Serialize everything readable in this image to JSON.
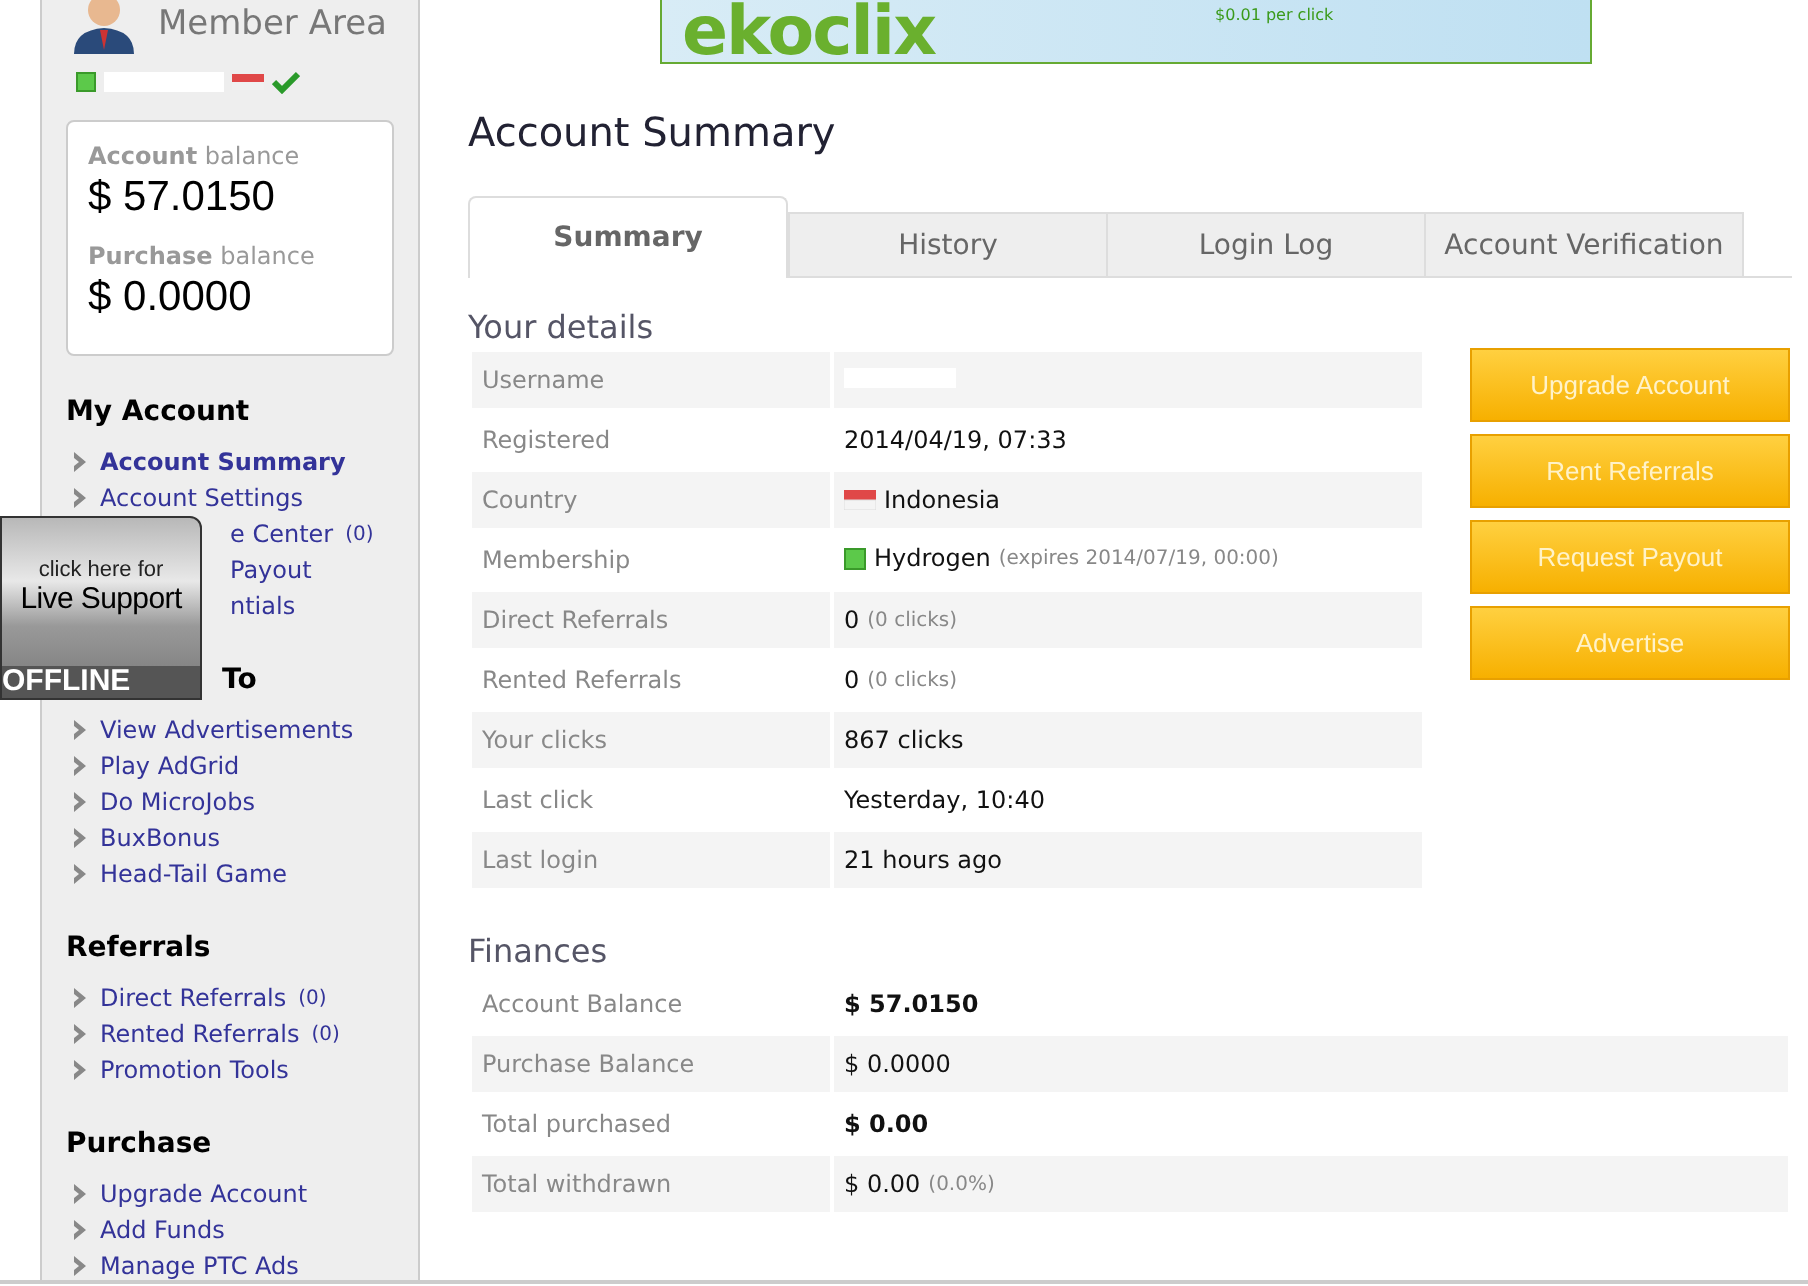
{
  "banner": {
    "logo": "ekoclix",
    "tagline": "$0.01 per click"
  },
  "sidebar": {
    "title": "Member Area",
    "balances": [
      {
        "label_bold": "Account",
        "label": "balance",
        "amount": "$ 57.0150"
      },
      {
        "label_bold": "Purchase",
        "label": "balance",
        "amount": "$ 0.0000"
      }
    ],
    "sections": [
      {
        "heading": "My Account",
        "kind": "full",
        "items": [
          {
            "label": "Account Summary",
            "kind": "full",
            "selected": true
          },
          {
            "label": "Account Settings",
            "kind": "full",
            "selected": false
          },
          {
            "label": "e Center",
            "count": "(0)",
            "kind": "partial",
            "selected": false
          },
          {
            "label": "Payout",
            "kind": "partial",
            "selected": false
          },
          {
            "label": "ntials",
            "kind": "partial",
            "selected": false
          }
        ]
      },
      {
        "heading": "To",
        "kind": "partial",
        "items": [
          {
            "label": "View Advertisements",
            "kind": "full",
            "selected": false
          },
          {
            "label": "Play AdGrid",
            "kind": "full",
            "selected": false
          },
          {
            "label": "Do MicroJobs",
            "kind": "full",
            "selected": false
          },
          {
            "label": "BuxBonus",
            "kind": "full",
            "selected": false
          },
          {
            "label": "Head-Tail Game",
            "kind": "full",
            "selected": false
          }
        ]
      },
      {
        "heading": "Referrals",
        "kind": "full",
        "items": [
          {
            "label": "Direct Referrals",
            "count": "(0)",
            "kind": "full",
            "selected": false
          },
          {
            "label": "Rented Referrals",
            "count": "(0)",
            "kind": "full",
            "selected": false
          },
          {
            "label": "Promotion Tools",
            "kind": "full",
            "selected": false
          }
        ]
      },
      {
        "heading": "Purchase",
        "kind": "full",
        "items": [
          {
            "label": "Upgrade Account",
            "kind": "full",
            "selected": false
          },
          {
            "label": "Add Funds",
            "kind": "full",
            "selected": false
          },
          {
            "label": "Manage PTC Ads",
            "kind": "full",
            "selected": false
          }
        ]
      }
    ]
  },
  "live_support": {
    "caption": "click here for",
    "title": "Live Support",
    "status": "OFFLINE"
  },
  "page_title": "Account Summary",
  "tabs": [
    {
      "label": "Summary",
      "selected": true
    },
    {
      "label": "History",
      "selected": false
    },
    {
      "label": "Login Log",
      "selected": false
    },
    {
      "label": "Account Verification",
      "selected": false
    }
  ],
  "details": {
    "title": "Your details",
    "rows": [
      {
        "label": "Username",
        "kind": "hidden"
      },
      {
        "label": "Registered",
        "kind": "text",
        "value": "2014/04/19, 07:33"
      },
      {
        "label": "Country",
        "kind": "country",
        "value": "Indonesia"
      },
      {
        "label": "Membership",
        "kind": "membership",
        "value": "Hydrogen",
        "note": "(expires 2014/07/19, 00:00)"
      },
      {
        "label": "Direct Referrals",
        "kind": "text",
        "value": "0",
        "note": "(0 clicks)"
      },
      {
        "label": "Rented Referrals",
        "kind": "text",
        "value": "0",
        "note": "(0 clicks)"
      },
      {
        "label": "Your clicks",
        "kind": "text",
        "value": "867 clicks"
      },
      {
        "label": "Last click",
        "kind": "text",
        "value": "Yesterday, 10:40"
      },
      {
        "label": "Last login",
        "kind": "text",
        "value": "21 hours ago"
      }
    ]
  },
  "actions": [
    "Upgrade Account",
    "Rent Referrals",
    "Request Payout",
    "Advertise"
  ],
  "finances": {
    "title": "Finances",
    "rows": [
      {
        "label": "Account Balance",
        "value": "$ 57.0150",
        "emphasized": true
      },
      {
        "label": "Purchase Balance",
        "value": "$ 0.0000",
        "emphasized": false
      },
      {
        "label": "Total purchased",
        "value": "$ 0.00",
        "emphasized": true
      },
      {
        "label": "Total withdrawn",
        "value": "$ 0.00",
        "note": "(0.0%)",
        "emphasized": false
      }
    ]
  }
}
